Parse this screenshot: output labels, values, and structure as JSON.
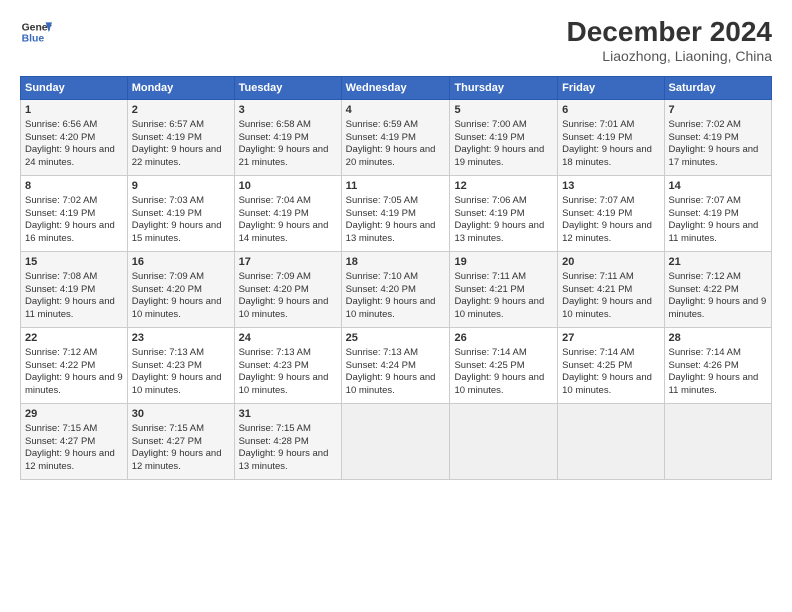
{
  "header": {
    "logo_line1": "General",
    "logo_line2": "Blue",
    "title": "December 2024",
    "subtitle": "Liaozhong, Liaoning, China"
  },
  "days_of_week": [
    "Sunday",
    "Monday",
    "Tuesday",
    "Wednesday",
    "Thursday",
    "Friday",
    "Saturday"
  ],
  "weeks": [
    [
      {
        "day": "1",
        "sunrise": "Sunrise: 6:56 AM",
        "sunset": "Sunset: 4:20 PM",
        "daylight": "Daylight: 9 hours and 24 minutes."
      },
      {
        "day": "2",
        "sunrise": "Sunrise: 6:57 AM",
        "sunset": "Sunset: 4:19 PM",
        "daylight": "Daylight: 9 hours and 22 minutes."
      },
      {
        "day": "3",
        "sunrise": "Sunrise: 6:58 AM",
        "sunset": "Sunset: 4:19 PM",
        "daylight": "Daylight: 9 hours and 21 minutes."
      },
      {
        "day": "4",
        "sunrise": "Sunrise: 6:59 AM",
        "sunset": "Sunset: 4:19 PM",
        "daylight": "Daylight: 9 hours and 20 minutes."
      },
      {
        "day": "5",
        "sunrise": "Sunrise: 7:00 AM",
        "sunset": "Sunset: 4:19 PM",
        "daylight": "Daylight: 9 hours and 19 minutes."
      },
      {
        "day": "6",
        "sunrise": "Sunrise: 7:01 AM",
        "sunset": "Sunset: 4:19 PM",
        "daylight": "Daylight: 9 hours and 18 minutes."
      },
      {
        "day": "7",
        "sunrise": "Sunrise: 7:02 AM",
        "sunset": "Sunset: 4:19 PM",
        "daylight": "Daylight: 9 hours and 17 minutes."
      }
    ],
    [
      {
        "day": "8",
        "sunrise": "Sunrise: 7:02 AM",
        "sunset": "Sunset: 4:19 PM",
        "daylight": "Daylight: 9 hours and 16 minutes."
      },
      {
        "day": "9",
        "sunrise": "Sunrise: 7:03 AM",
        "sunset": "Sunset: 4:19 PM",
        "daylight": "Daylight: 9 hours and 15 minutes."
      },
      {
        "day": "10",
        "sunrise": "Sunrise: 7:04 AM",
        "sunset": "Sunset: 4:19 PM",
        "daylight": "Daylight: 9 hours and 14 minutes."
      },
      {
        "day": "11",
        "sunrise": "Sunrise: 7:05 AM",
        "sunset": "Sunset: 4:19 PM",
        "daylight": "Daylight: 9 hours and 13 minutes."
      },
      {
        "day": "12",
        "sunrise": "Sunrise: 7:06 AM",
        "sunset": "Sunset: 4:19 PM",
        "daylight": "Daylight: 9 hours and 13 minutes."
      },
      {
        "day": "13",
        "sunrise": "Sunrise: 7:07 AM",
        "sunset": "Sunset: 4:19 PM",
        "daylight": "Daylight: 9 hours and 12 minutes."
      },
      {
        "day": "14",
        "sunrise": "Sunrise: 7:07 AM",
        "sunset": "Sunset: 4:19 PM",
        "daylight": "Daylight: 9 hours and 11 minutes."
      }
    ],
    [
      {
        "day": "15",
        "sunrise": "Sunrise: 7:08 AM",
        "sunset": "Sunset: 4:19 PM",
        "daylight": "Daylight: 9 hours and 11 minutes."
      },
      {
        "day": "16",
        "sunrise": "Sunrise: 7:09 AM",
        "sunset": "Sunset: 4:20 PM",
        "daylight": "Daylight: 9 hours and 10 minutes."
      },
      {
        "day": "17",
        "sunrise": "Sunrise: 7:09 AM",
        "sunset": "Sunset: 4:20 PM",
        "daylight": "Daylight: 9 hours and 10 minutes."
      },
      {
        "day": "18",
        "sunrise": "Sunrise: 7:10 AM",
        "sunset": "Sunset: 4:20 PM",
        "daylight": "Daylight: 9 hours and 10 minutes."
      },
      {
        "day": "19",
        "sunrise": "Sunrise: 7:11 AM",
        "sunset": "Sunset: 4:21 PM",
        "daylight": "Daylight: 9 hours and 10 minutes."
      },
      {
        "day": "20",
        "sunrise": "Sunrise: 7:11 AM",
        "sunset": "Sunset: 4:21 PM",
        "daylight": "Daylight: 9 hours and 10 minutes."
      },
      {
        "day": "21",
        "sunrise": "Sunrise: 7:12 AM",
        "sunset": "Sunset: 4:22 PM",
        "daylight": "Daylight: 9 hours and 9 minutes."
      }
    ],
    [
      {
        "day": "22",
        "sunrise": "Sunrise: 7:12 AM",
        "sunset": "Sunset: 4:22 PM",
        "daylight": "Daylight: 9 hours and 9 minutes."
      },
      {
        "day": "23",
        "sunrise": "Sunrise: 7:13 AM",
        "sunset": "Sunset: 4:23 PM",
        "daylight": "Daylight: 9 hours and 10 minutes."
      },
      {
        "day": "24",
        "sunrise": "Sunrise: 7:13 AM",
        "sunset": "Sunset: 4:23 PM",
        "daylight": "Daylight: 9 hours and 10 minutes."
      },
      {
        "day": "25",
        "sunrise": "Sunrise: 7:13 AM",
        "sunset": "Sunset: 4:24 PM",
        "daylight": "Daylight: 9 hours and 10 minutes."
      },
      {
        "day": "26",
        "sunrise": "Sunrise: 7:14 AM",
        "sunset": "Sunset: 4:25 PM",
        "daylight": "Daylight: 9 hours and 10 minutes."
      },
      {
        "day": "27",
        "sunrise": "Sunrise: 7:14 AM",
        "sunset": "Sunset: 4:25 PM",
        "daylight": "Daylight: 9 hours and 10 minutes."
      },
      {
        "day": "28",
        "sunrise": "Sunrise: 7:14 AM",
        "sunset": "Sunset: 4:26 PM",
        "daylight": "Daylight: 9 hours and 11 minutes."
      }
    ],
    [
      {
        "day": "29",
        "sunrise": "Sunrise: 7:15 AM",
        "sunset": "Sunset: 4:27 PM",
        "daylight": "Daylight: 9 hours and 12 minutes."
      },
      {
        "day": "30",
        "sunrise": "Sunrise: 7:15 AM",
        "sunset": "Sunset: 4:27 PM",
        "daylight": "Daylight: 9 hours and 12 minutes."
      },
      {
        "day": "31",
        "sunrise": "Sunrise: 7:15 AM",
        "sunset": "Sunset: 4:28 PM",
        "daylight": "Daylight: 9 hours and 13 minutes."
      },
      null,
      null,
      null,
      null
    ]
  ]
}
